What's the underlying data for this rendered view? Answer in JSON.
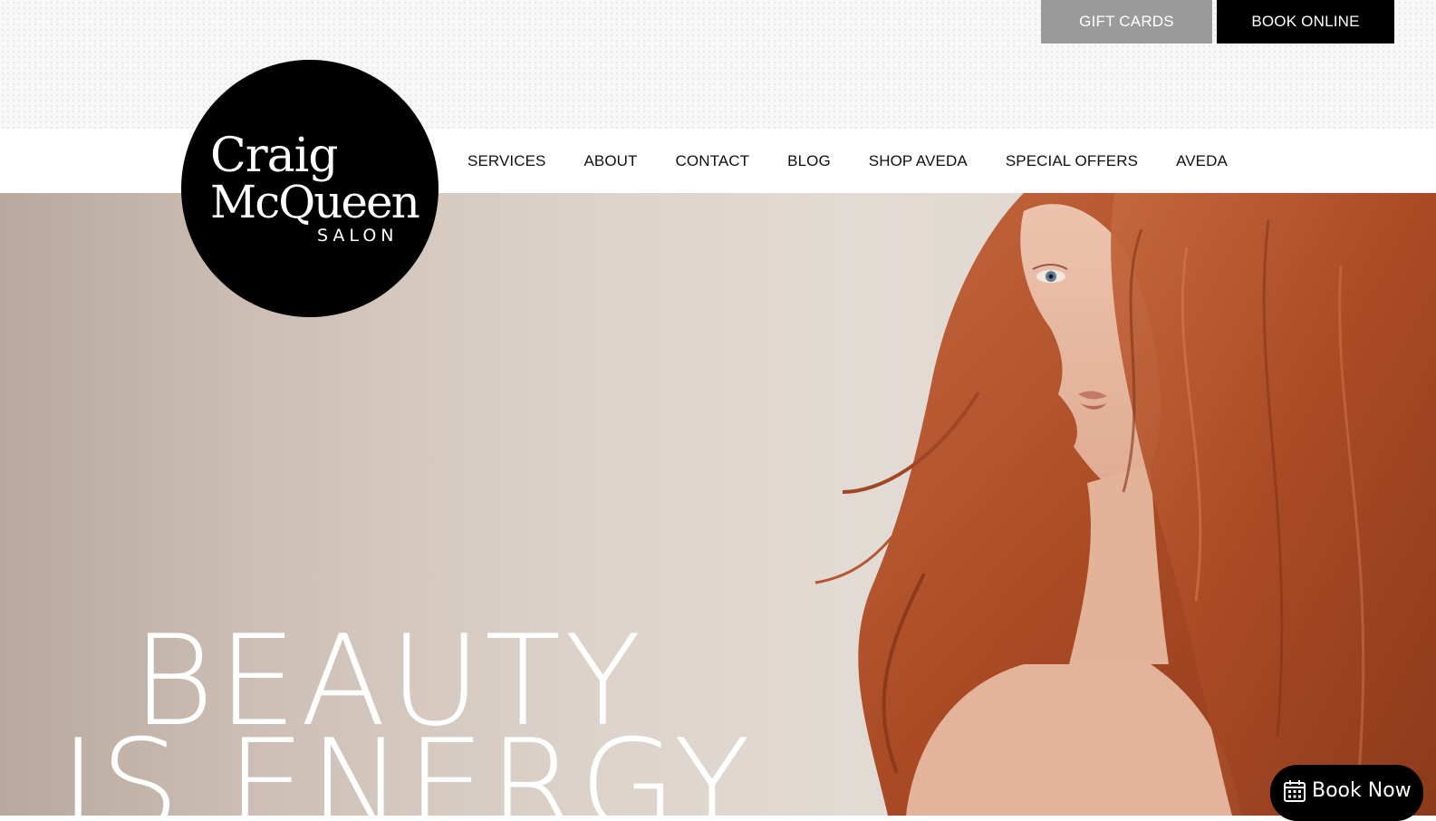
{
  "top_buttons": {
    "gift_cards": "GIFT CARDS",
    "book_online": "BOOK ONLINE"
  },
  "logo": {
    "line1": "Craig",
    "line2": "McQueen",
    "sub": "SALON"
  },
  "nav": {
    "items": [
      {
        "label": "SERVICES"
      },
      {
        "label": "ABOUT"
      },
      {
        "label": "CONTACT"
      },
      {
        "label": "BLOG"
      },
      {
        "label": "SHOP AVEDA"
      },
      {
        "label": "SPECIAL OFFERS"
      },
      {
        "label": "AVEDA"
      }
    ]
  },
  "hero": {
    "headline_line1": "BEAUTY",
    "headline_line2": "IS ENERGY"
  },
  "widget": {
    "book_now_label": "Book Now",
    "icon": "calendar-icon"
  },
  "colors": {
    "gift_btn_bg": "#9b9b9b",
    "book_online_bg": "#000000",
    "hair": "#b5532c"
  }
}
